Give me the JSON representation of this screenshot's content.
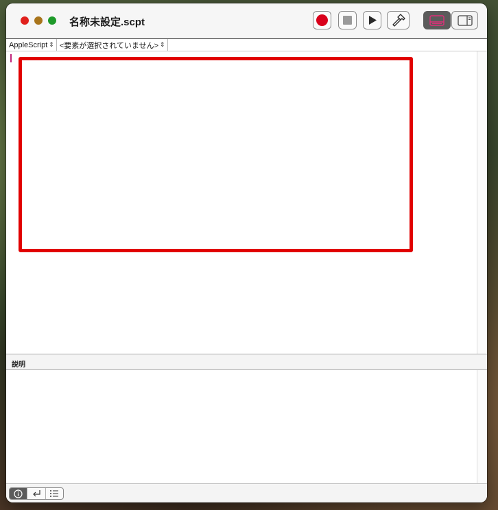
{
  "window": {
    "title": "名称未設定.scpt"
  },
  "toolbar": {
    "record": "record-button",
    "stop": "stop-button",
    "run": "run-button",
    "compile": "compile-button",
    "colors": {
      "record": "#d9001b",
      "accent": "#e10000"
    }
  },
  "navbar": {
    "language": "AppleScript",
    "element": "<要素が選択されていません>"
  },
  "description": {
    "label": "説明"
  },
  "bottom": {
    "buttons": [
      "info-icon",
      "return-icon",
      "list-icon"
    ]
  }
}
